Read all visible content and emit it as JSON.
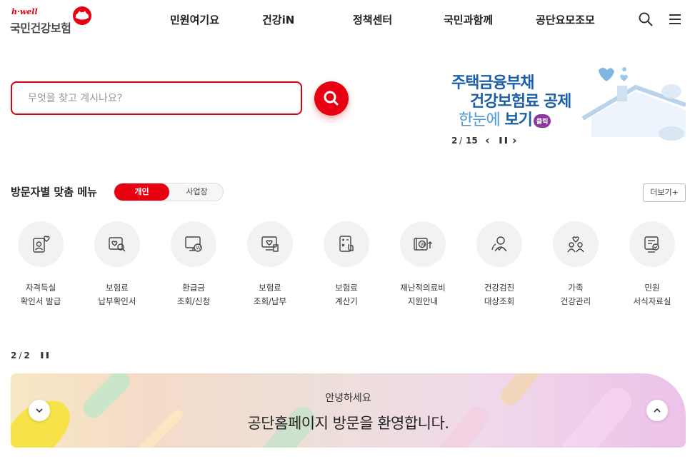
{
  "header": {
    "logo_hwell": "h·well",
    "logo_name": "국민건강보험",
    "nav": [
      "민원여기요",
      "건강iN",
      "정책센터",
      "국민과함께",
      "공단요모조모"
    ]
  },
  "search": {
    "placeholder": "무엇을 찾고 계시나요?"
  },
  "banner": {
    "line1": "주택금융부채",
    "line2": "건강보험료 공제",
    "line3a": "한눈에",
    "line3b": " 보기",
    "badge": "클릭",
    "page_current": "2",
    "page_total": "15",
    "separator": "/",
    "prev": "‹",
    "pause": "❚❚",
    "next": "›"
  },
  "custom_menu": {
    "title": "방문자별 맞춤 메뉴",
    "tab_personal": "개인",
    "tab_business": "사업장",
    "more": "더보기+",
    "items": [
      {
        "line1": "자격득실",
        "line2": "확인서 발급",
        "icon": "person-heart-icon"
      },
      {
        "line1": "보험료",
        "line2": "납부확인서",
        "icon": "document-search-icon"
      },
      {
        "line1": "환급금",
        "line2": "조회/신청",
        "icon": "monitor-won-icon"
      },
      {
        "line1": "보험료",
        "line2": "조회/납부",
        "icon": "monitor-heart-icon"
      },
      {
        "line1": "보험료",
        "line2": "계산기",
        "icon": "calculator-icon"
      },
      {
        "line1": "재난적의료비",
        "line2": "지원안내",
        "icon": "money-support-icon"
      },
      {
        "line1": "건강검진",
        "line2": "대상조회",
        "icon": "people-check-icon"
      },
      {
        "line1": "가족",
        "line2": "건강관리",
        "icon": "family-heart-icon"
      },
      {
        "line1": "민원",
        "line2": "서식자료실",
        "icon": "form-document-icon"
      }
    ]
  },
  "welcome": {
    "page_current": "2",
    "page_total": "2",
    "separator": "/",
    "pause": "❚❚",
    "greeting": "안녕하세요",
    "message": "공단홈페이지 방문을 환영합니다."
  },
  "colors": {
    "brand_red": "#e60012",
    "banner_blue": "#1c5fa8"
  }
}
